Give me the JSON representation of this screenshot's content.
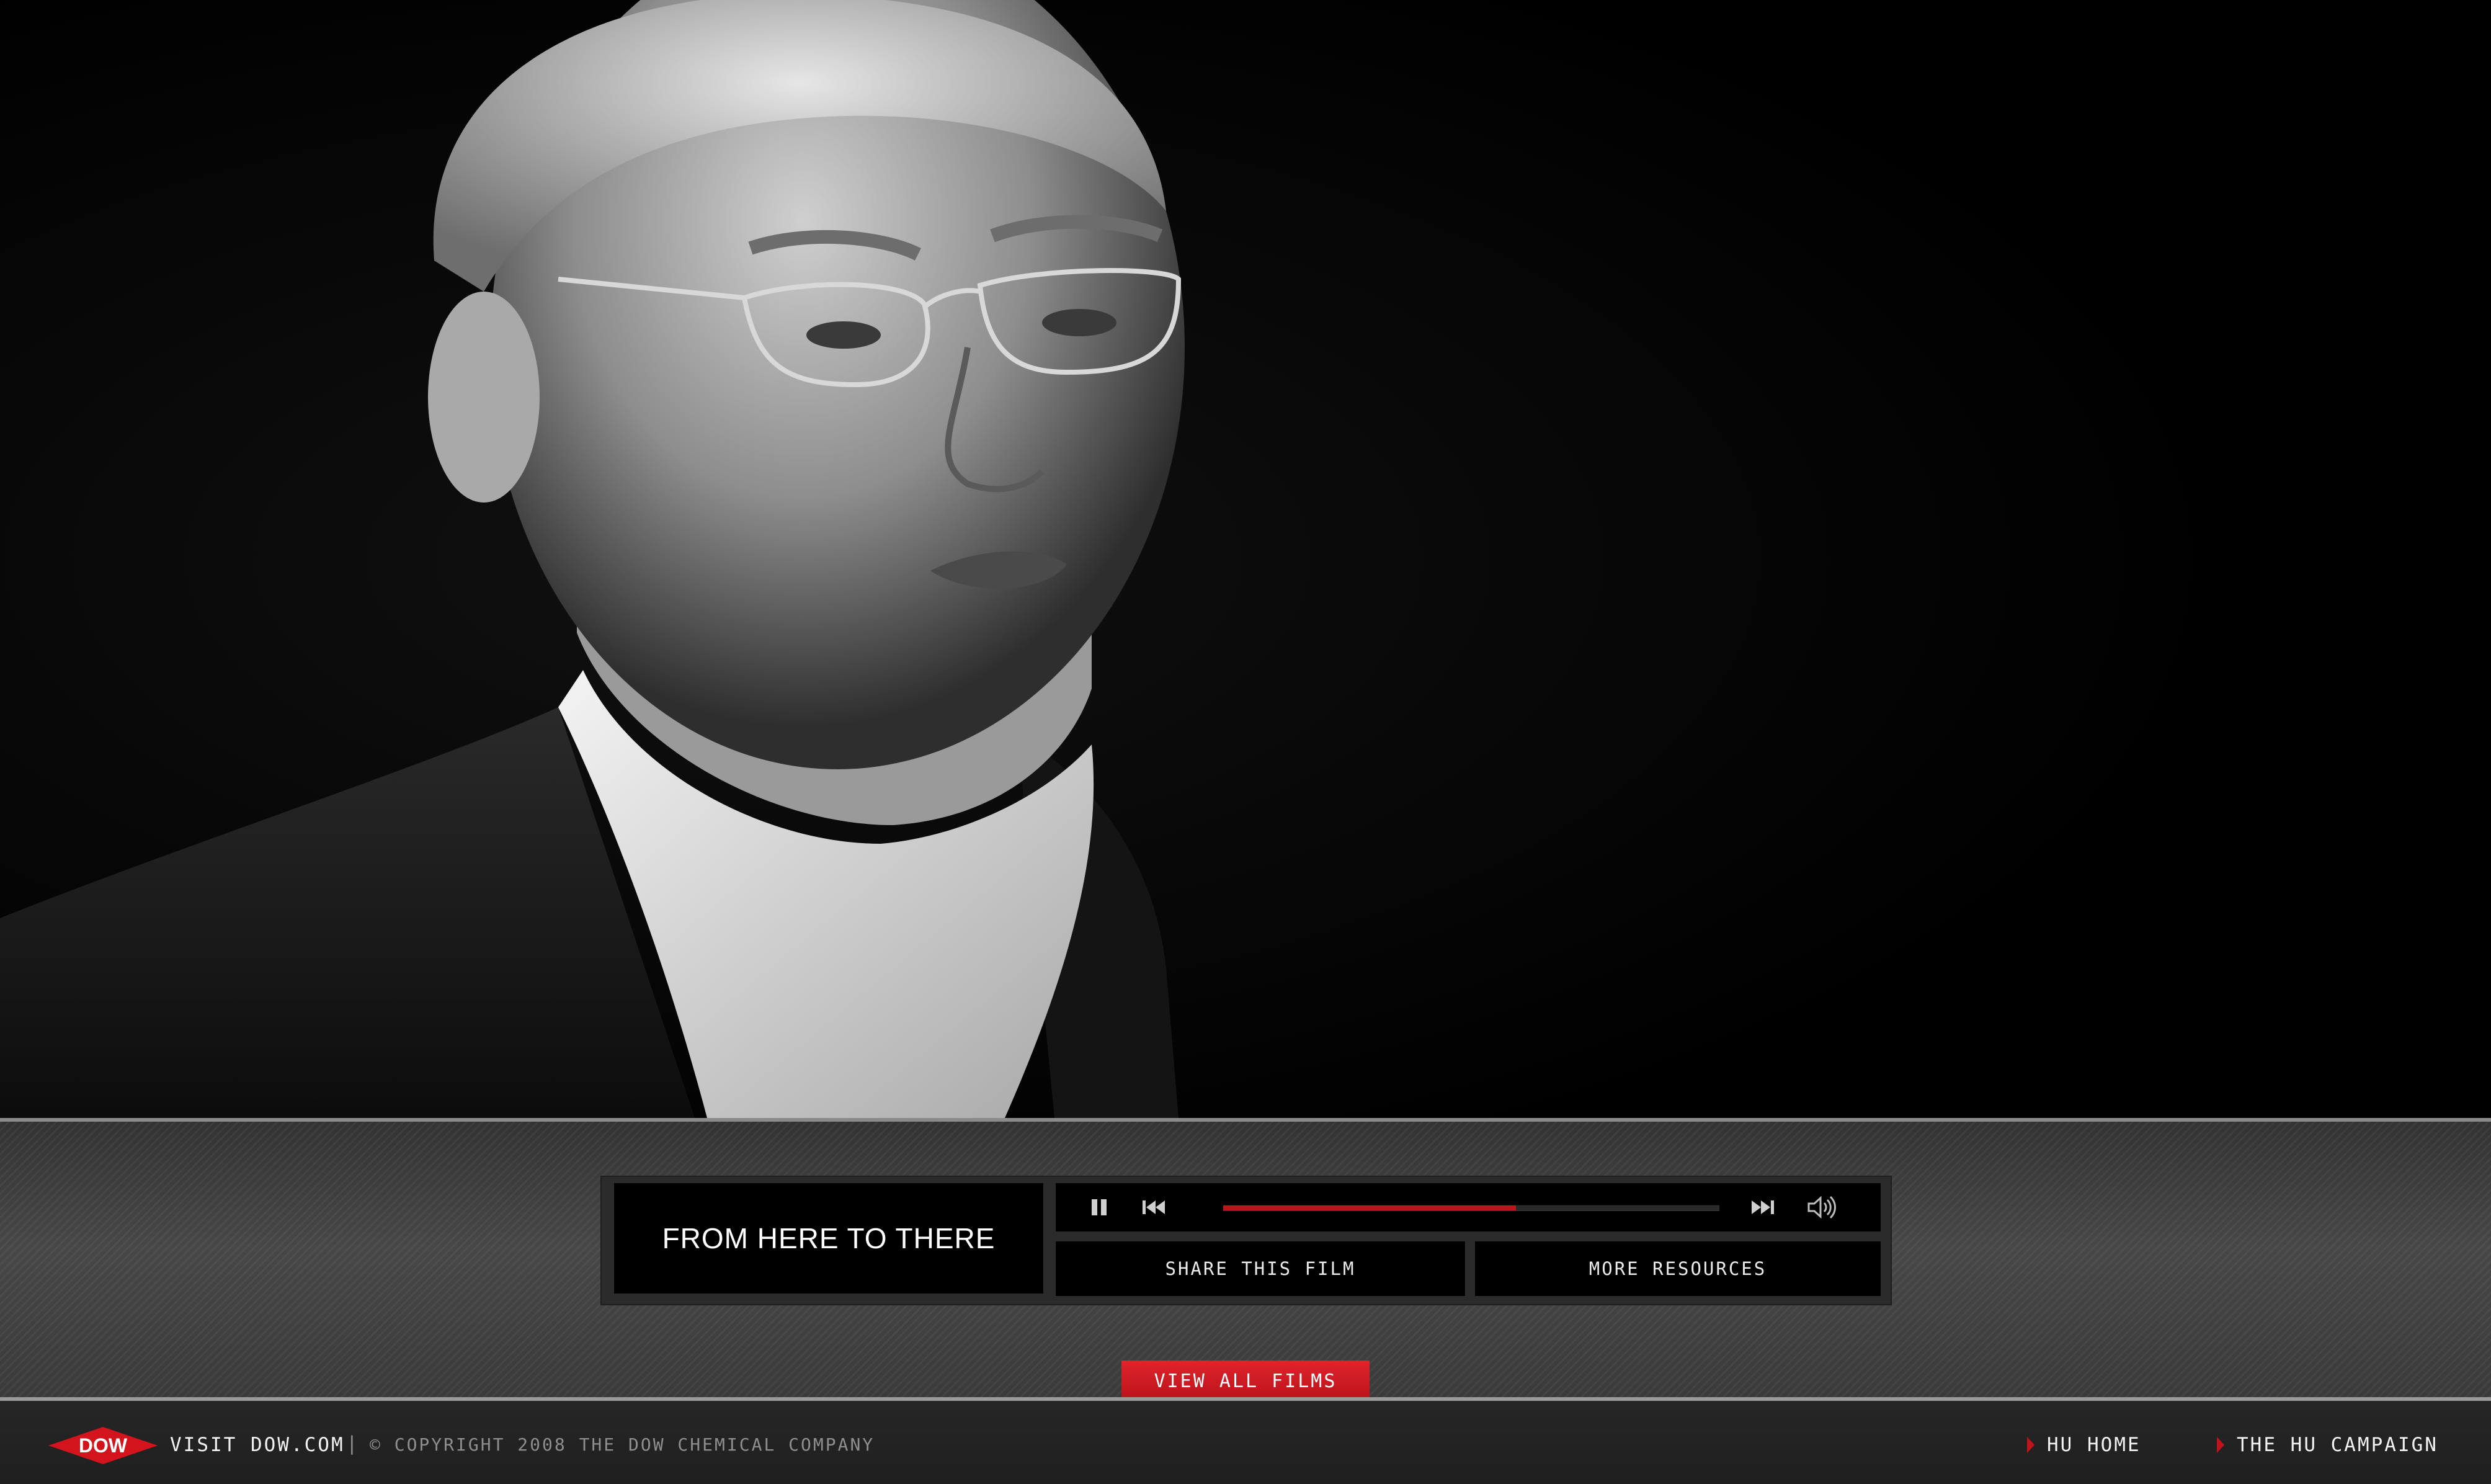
{
  "film": {
    "title": "FROM HERE TO THERE"
  },
  "player": {
    "progress": 0.59,
    "progress_color": "#c0141c",
    "icons": {
      "pause": "pause-icon",
      "previous": "skip-back-icon",
      "next": "skip-forward-icon",
      "volume": "volume-icon"
    }
  },
  "actions": {
    "share_label": "SHARE THIS FILM",
    "resources_label": "MORE RESOURCES",
    "view_all_label": "VIEW ALL FILMS"
  },
  "footer": {
    "logo_text": "DOW",
    "visit_label": "VISIT DOW.COM",
    "separator": "|",
    "copyright": "© COPYRIGHT 2008 THE DOW CHEMICAL COMPANY",
    "links": [
      {
        "label": "HU HOME"
      },
      {
        "label": "THE HU CAMPAIGN"
      }
    ]
  },
  "colors": {
    "accent": "#c0141c",
    "background": "#000000",
    "band": "#3b3b3b"
  }
}
